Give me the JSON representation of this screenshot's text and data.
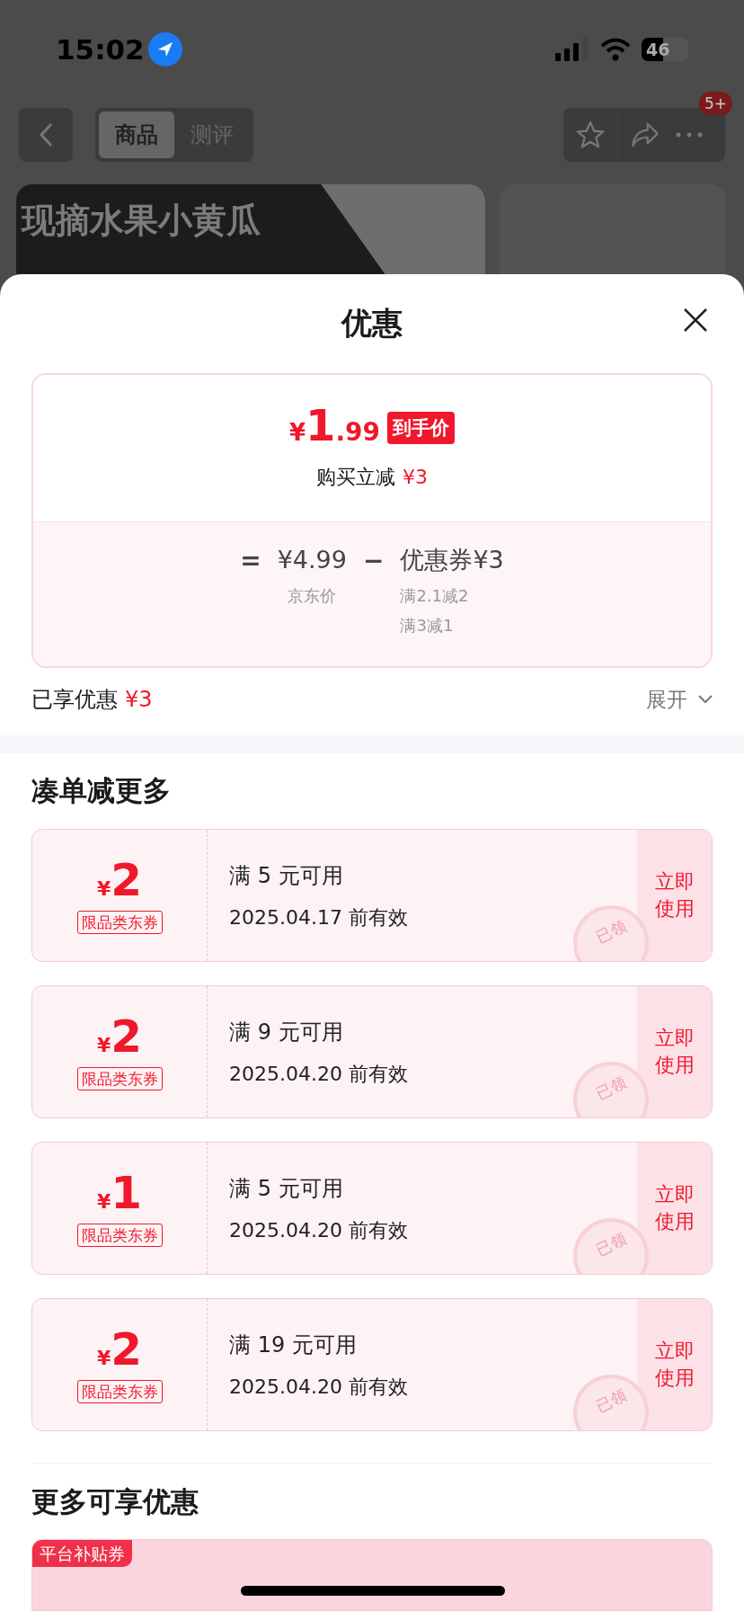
{
  "status_bar": {
    "time": "15:02",
    "battery": "46"
  },
  "nav": {
    "tabs": [
      {
        "label": "商品",
        "selected": true
      },
      {
        "label": "测评",
        "selected": false
      }
    ],
    "badge": "5+"
  },
  "banner": {
    "title": "现摘水果小黄瓜"
  },
  "sheet": {
    "title": "优惠",
    "price": {
      "currency": "¥",
      "integer": "1",
      "decimal": ".99",
      "tag": "到手价"
    },
    "instant": {
      "label": "购买立减",
      "amount": "¥3"
    },
    "breakdown": {
      "equals": "=",
      "base_price": "¥4.99",
      "base_label": "京东价",
      "minus": "−",
      "coupon_label": "优惠券¥3",
      "rules": [
        "满2.1减2",
        "满3减1"
      ]
    },
    "enjoyed": {
      "label": "已享优惠",
      "amount": "¥3"
    },
    "expand": "展开",
    "section_title": "凑单减更多",
    "coupons": [
      {
        "currency": "¥",
        "amount": "2",
        "tag": "限品类东券",
        "condition": "满 5 元可用",
        "validity": "2025.04.17 前有效",
        "action": "立即使用",
        "stamp": "已领"
      },
      {
        "currency": "¥",
        "amount": "2",
        "tag": "限品类东券",
        "condition": "满 9 元可用",
        "validity": "2025.04.20 前有效",
        "action": "立即使用",
        "stamp": "已领"
      },
      {
        "currency": "¥",
        "amount": "1",
        "tag": "限品类东券",
        "condition": "满 5 元可用",
        "validity": "2025.04.20 前有效",
        "action": "立即使用",
        "stamp": "已领"
      },
      {
        "currency": "¥",
        "amount": "2",
        "tag": "限品类东券",
        "condition": "满 19 元可用",
        "validity": "2025.04.20 前有效",
        "action": "立即使用",
        "stamp": "已领"
      }
    ],
    "more_title": "更多可享优惠",
    "more_coupons": [
      {
        "tag": "平台补贴券"
      }
    ]
  }
}
